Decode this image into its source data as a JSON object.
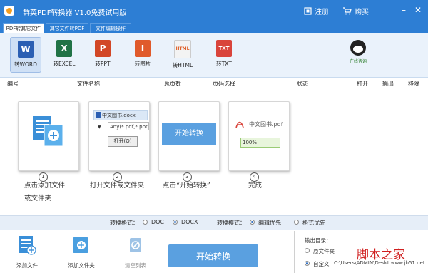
{
  "app": {
    "title": "群英PDF转换器 V1.0免费试用版",
    "register": "注册",
    "buy": "购买"
  },
  "tabs": [
    "PDF转其它文件",
    "其它文件转PDF",
    "文件编辑操作"
  ],
  "toolbar": [
    {
      "label": "转WORD",
      "glyph": "W",
      "color": "#2b5fb3",
      "active": true
    },
    {
      "label": "转EXCEL",
      "glyph": "X",
      "color": "#217346",
      "active": false
    },
    {
      "label": "转PPT",
      "glyph": "P",
      "color": "#d24726",
      "active": false
    },
    {
      "label": "转图片",
      "glyph": "I",
      "color": "#e05a2b",
      "active": false
    },
    {
      "label": "转HTML",
      "glyph": "HTML",
      "color": "#f0f0f0",
      "active": false
    },
    {
      "label": "转TXT",
      "glyph": "TXT",
      "color": "#d9443b",
      "active": false
    }
  ],
  "qq": {
    "label": "在线咨询"
  },
  "columns": {
    "number": "编号",
    "filename": "文件名称",
    "pages": "总页数",
    "page_select": "页码选择",
    "status": "状态",
    "open": "打开",
    "output": "输出",
    "remove": "移除"
  },
  "steps": [
    {
      "num": "1",
      "line1": "点击添加文件",
      "line2": "或文件夹"
    },
    {
      "num": "2",
      "line1": "打开文件或文件夹",
      "line2": ""
    },
    {
      "num": "3",
      "line1": "点击“开始转换”",
      "line2": ""
    },
    {
      "num": "4",
      "line1": "完成",
      "line2": ""
    }
  ],
  "panel2": {
    "file": "中文图书.docx",
    "filter": "Any(*.pdf,*.ppt,*",
    "open_btn": "打开(O)"
  },
  "panel3": {
    "button": "开始转换"
  },
  "panel4": {
    "file": "中文图书.pdf",
    "progress": "100%",
    "progress_value": 100
  },
  "settings": {
    "format_label": "转换格式：",
    "format_options": [
      "DOC",
      "DOCX"
    ],
    "format_selected": "DOCX",
    "mode_label": "转换模式：",
    "mode_options": [
      "编辑优先",
      "格式优先"
    ],
    "mode_selected": "编辑优先"
  },
  "bottom": {
    "add_file": "添加文件",
    "add_folder": "添加文件夹",
    "clear_list": "清空列表",
    "start": "开始转换"
  },
  "output_dir": {
    "label": "输出目录：",
    "option_original": "原文件夹",
    "option_custom": "自定义",
    "selected": "自定义",
    "path": "C:\\Users\\ADMIN\\Deskt"
  },
  "watermark": {
    "text": "脚本之家",
    "url": "www.jb51.net"
  },
  "colors": {
    "titlebar": "#2d7ed4",
    "toolbar_bg": "#eaf2fb",
    "start_button": "#5aa0e0",
    "settings_bar": "#e6eef8"
  }
}
